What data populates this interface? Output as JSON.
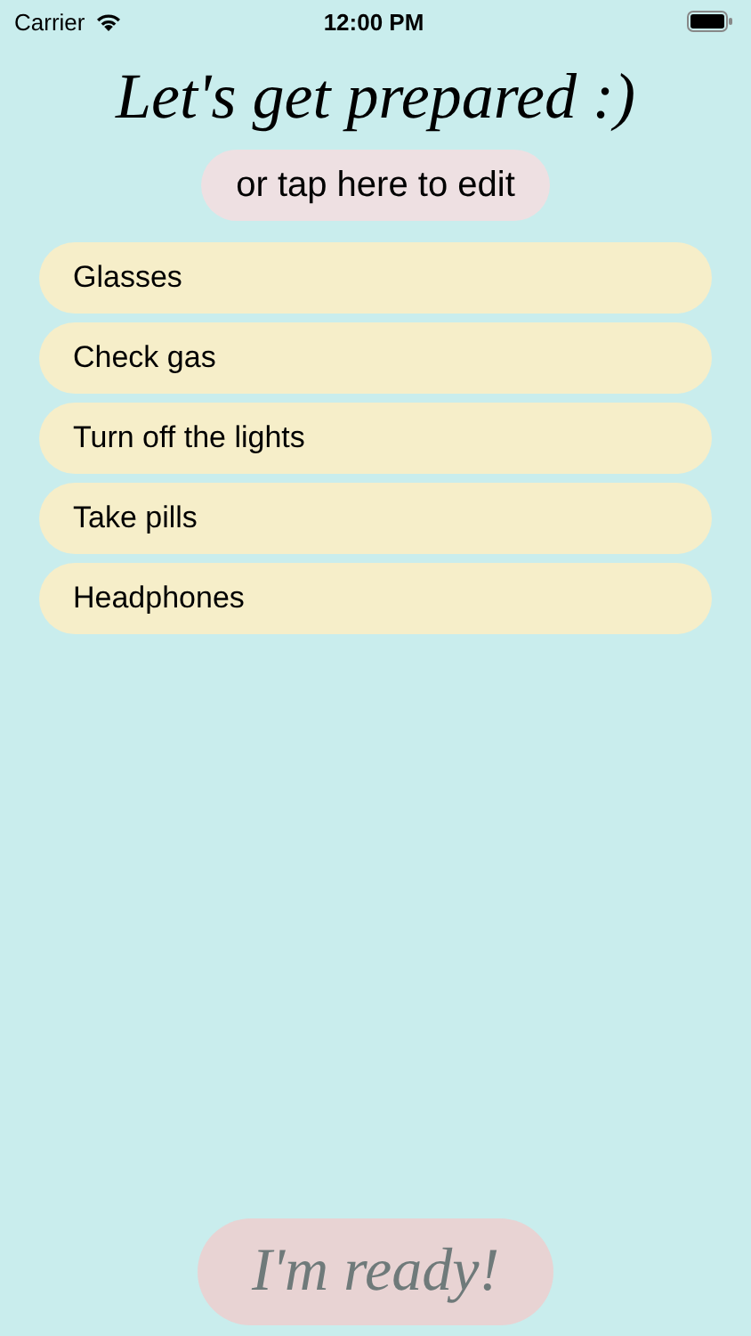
{
  "status_bar": {
    "carrier": "Carrier",
    "time": "12:00 PM"
  },
  "title": "Let's get prepared :)",
  "edit_button": "or tap here to edit",
  "items": [
    {
      "label": "Glasses"
    },
    {
      "label": "Check gas"
    },
    {
      "label": "Turn off the lights"
    },
    {
      "label": "Take pills"
    },
    {
      "label": "Headphones"
    }
  ],
  "ready_button": "I'm ready!"
}
